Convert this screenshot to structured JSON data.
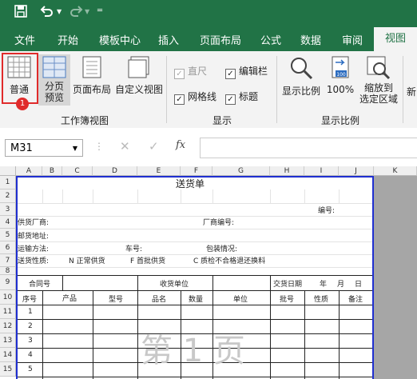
{
  "qat": {
    "save_icon": "save-icon",
    "undo_icon": "undo-icon",
    "redo_icon": "redo-icon",
    "customize_icon": "customize-icon"
  },
  "tabs": [
    "文件",
    "开始",
    "模板中心",
    "插入",
    "页面布局",
    "公式",
    "数据",
    "审阅",
    "视图"
  ],
  "ribbon": {
    "normal_label": "普通",
    "page_break_label": "分页\n预览",
    "page_layout_label": "页面布局",
    "custom_view_label": "自定义视图",
    "workbook_views_group": "工作簿视图",
    "ruler_label": "直尺",
    "formula_bar_label": "编辑栏",
    "gridlines_label": "网格线",
    "headings_label": "标题",
    "show_group": "显示",
    "zoom_label": "显示比例",
    "zoom100_label": "100%",
    "zoom_selection_label": "缩放到\n选定区域",
    "zoom_group": "显示比例",
    "new_label": "新",
    "badge": "1"
  },
  "formula": {
    "name_box": "M31",
    "fx": "fx"
  },
  "columns": [
    "A",
    "B",
    "C",
    "D",
    "E",
    "F",
    "G",
    "H",
    "I",
    "J",
    "K"
  ],
  "rows": [
    "1",
    "2",
    "3",
    "4",
    "5",
    "6",
    "7",
    "8",
    "9",
    "10",
    "11",
    "12",
    "13",
    "14",
    "15"
  ],
  "sheet": {
    "title": "送货单",
    "number": "编号:",
    "supplier": "供货厂商:",
    "vendor_no": "厂商编号:",
    "address": "邮货地址:",
    "transport": "运输方法:",
    "car_no": "车号:",
    "package": "包装情况:",
    "delivery_type": "送货性质:",
    "n_label": "N 正常供货",
    "f_label": "F 首批供货",
    "c_label": "C 质检不合格退还换料",
    "contract": "合同号",
    "receiver": "收货单位",
    "delivery_date": "交货日期",
    "year": "年",
    "month": "月",
    "day": "日",
    "h_seq": "序号",
    "h_product": "产品",
    "h_model": "型号",
    "h_name": "品名",
    "h_qty": "数量",
    "h_unit": "单位",
    "h_batch": "批号",
    "h_nature": "性质",
    "h_note": "备注",
    "seq": [
      "1",
      "2",
      "3",
      "4",
      "5"
    ],
    "watermark": "第 1 页"
  }
}
